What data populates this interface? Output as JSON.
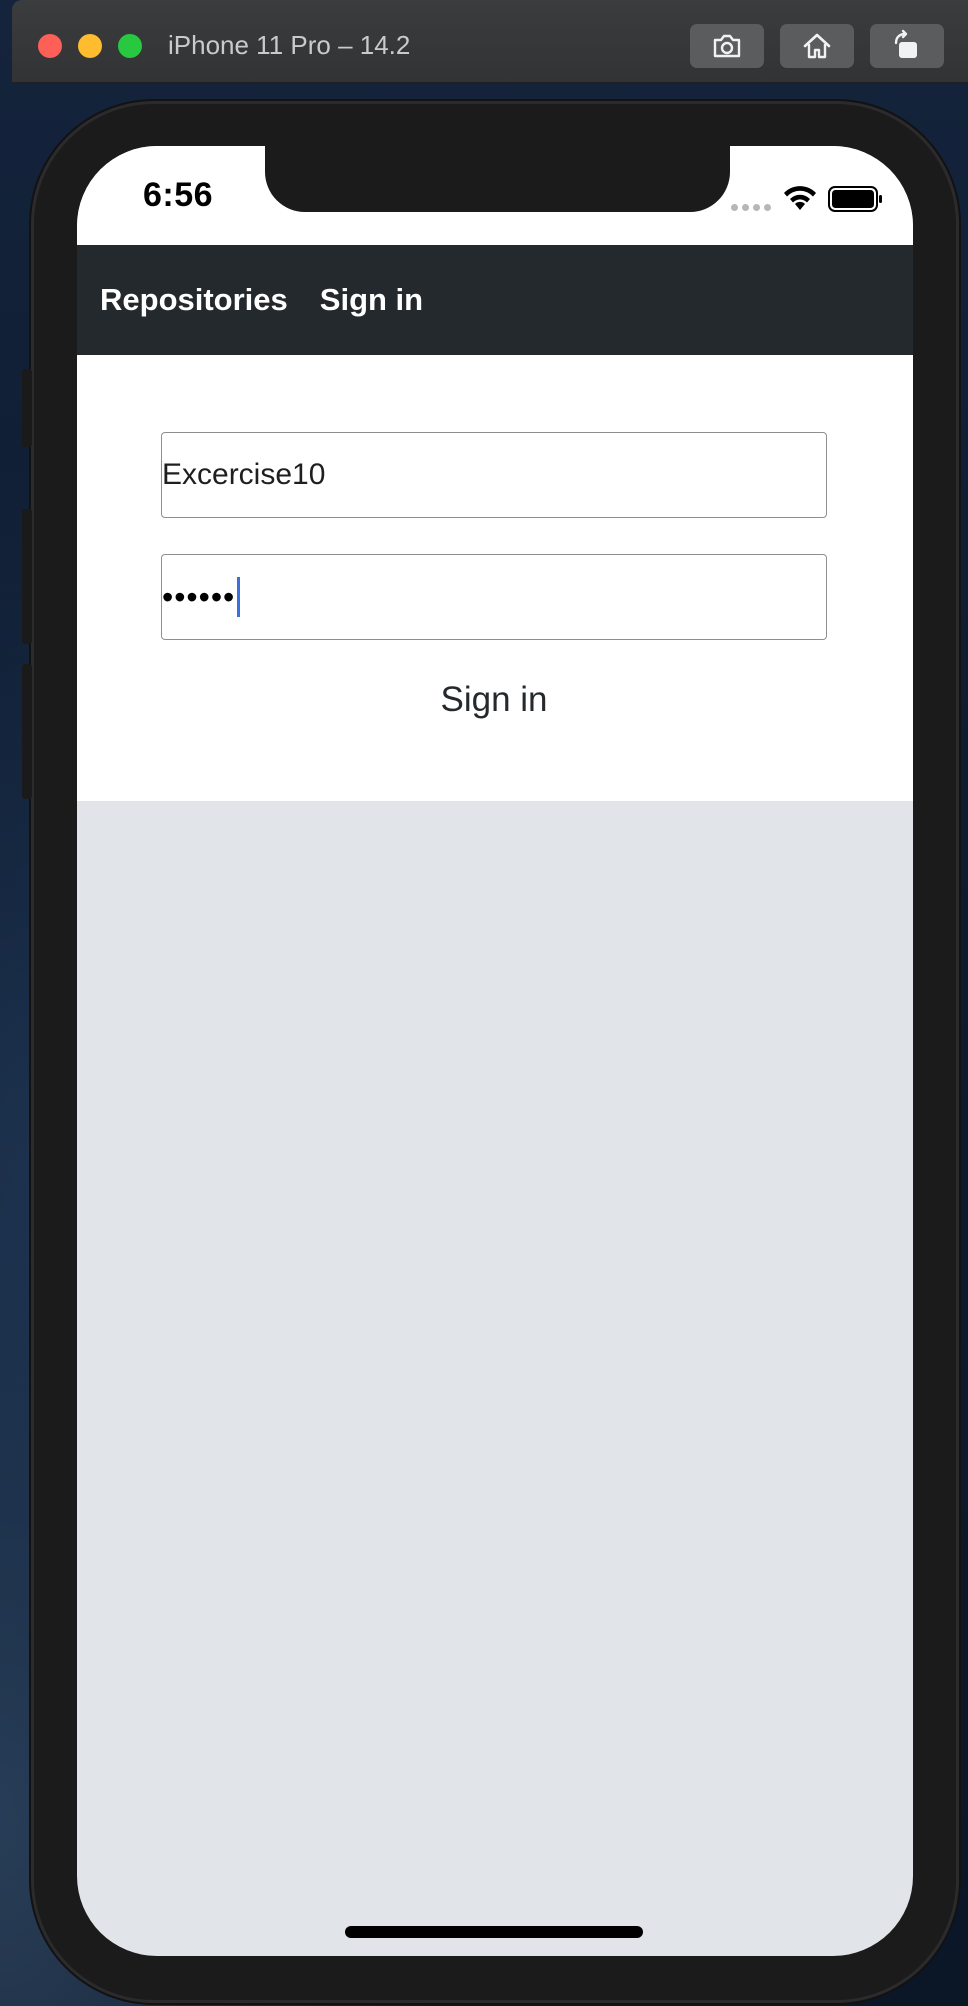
{
  "window": {
    "title": "iPhone 11 Pro – 14.2",
    "toolbar_icons": [
      "screenshot-icon",
      "home-icon",
      "rotate-icon"
    ]
  },
  "status_bar": {
    "time": "6:56",
    "icons": [
      "signal-icon",
      "wifi-icon",
      "battery-icon"
    ]
  },
  "app_bar": {
    "tabs": [
      {
        "label": "Repositories"
      },
      {
        "label": "Sign in"
      }
    ],
    "background": "#24292e"
  },
  "form": {
    "username_value": "Excercise10",
    "password_value": "••••••",
    "submit_label": "Sign in"
  },
  "colors": {
    "content_background": "#e1e4e9",
    "caret": "#3b6fe0"
  }
}
